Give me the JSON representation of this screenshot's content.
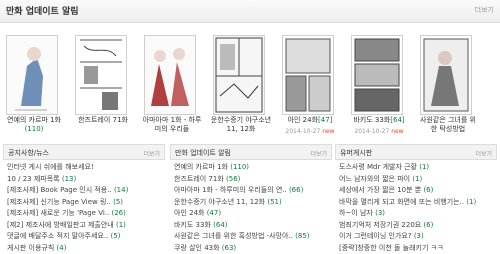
{
  "header": {
    "title": "만화 업데이트 알림",
    "more": "더보기"
  },
  "cards": [
    {
      "title": "연예의 카르마 1화",
      "count": "(110)",
      "date": "",
      "new": ""
    },
    {
      "title": "한즈트레이 71화",
      "count": "",
      "date": "",
      "new": ""
    },
    {
      "title": "아마아마 1화 - 하루미의 우리들",
      "count": "",
      "date": "",
      "new": ""
    },
    {
      "title": "운한수증기 야구소년 11, 12화",
      "count": "",
      "date": "",
      "new": ""
    },
    {
      "title": "아인 24화",
      "count": "[47]",
      "date": "2014-10-27",
      "new": "new"
    },
    {
      "title": "바키도 33화",
      "count": "[64]",
      "date": "2014-10-27",
      "new": "new"
    },
    {
      "title": "사원같은 그녀를 위한 탁성방법",
      "count": "",
      "date": "",
      "new": ""
    }
  ],
  "panels": [
    {
      "title": "공지사항/뉴스",
      "more": "더보기",
      "items": [
        {
          "text": "인터넷 게시 쉬에를 해보세요!",
          "count": ""
        },
        {
          "text": "10 / 23 제파목록",
          "count": "(13)"
        },
        {
          "text": "[제조사제] Book Page 인시 적용..",
          "count": "(14)"
        },
        {
          "text": "[제조사제] 신기능 Page View 링..",
          "count": "(5)"
        },
        {
          "text": "[제조사제] 새로운 기능 'Page Vi..",
          "count": "(26)"
        },
        {
          "text": "[제2] 제조사에 방배일판고 제출안내",
          "count": "(1)"
        },
        {
          "text": "댓글에 배달주소 적지 말아주세요..",
          "count": "(5)"
        },
        {
          "text": "게시판 이용규칙",
          "count": "(4)"
        }
      ]
    },
    {
      "title": "만화 업데이트 알림",
      "more": "더보기",
      "items": [
        {
          "text": "연예의 카르마 1화",
          "count": "(110)"
        },
        {
          "text": "한즈트레이 71화",
          "count": "(56)"
        },
        {
          "text": "아마아마 1화 - 하루미의 우리들의 연..",
          "count": "(66)"
        },
        {
          "text": "운한수증기 야구소년 11, 12화",
          "count": "(51)"
        },
        {
          "text": "아인 24화",
          "count": "(47)"
        },
        {
          "text": "바키도 33화",
          "count": "(64)"
        },
        {
          "text": "사원같은 그녀를 위한 흑성방법 -사망아..",
          "count": "(85)"
        },
        {
          "text": "쿠랑 살인 43화",
          "count": "(63)"
        }
      ]
    },
    {
      "title": "유머게시판",
      "more": "더보기",
      "items": [
        {
          "text": "도스사령 Mdr 게발자 근황",
          "count": "(1)"
        },
        {
          "text": "어느 남자와의 짧은 파이",
          "count": "(1)"
        },
        {
          "text": "세상에서 가장 짧은 10분 뿐",
          "count": "(6)"
        },
        {
          "text": "바막을 멸리게 되고 화면에 또는 비행기는..",
          "count": "(1)"
        },
        {
          "text": "하~이 남자",
          "count": "(3)"
        },
        {
          "text": "범죄기억처 저장기권 220요",
          "count": "(6)"
        },
        {
          "text": "이거 그런테이닝 인가요?",
          "count": "(3)"
        },
        {
          "text": "[중략]창중한 이천 돌 놀래키기 ㅋㅋ",
          "count": ""
        }
      ]
    }
  ]
}
